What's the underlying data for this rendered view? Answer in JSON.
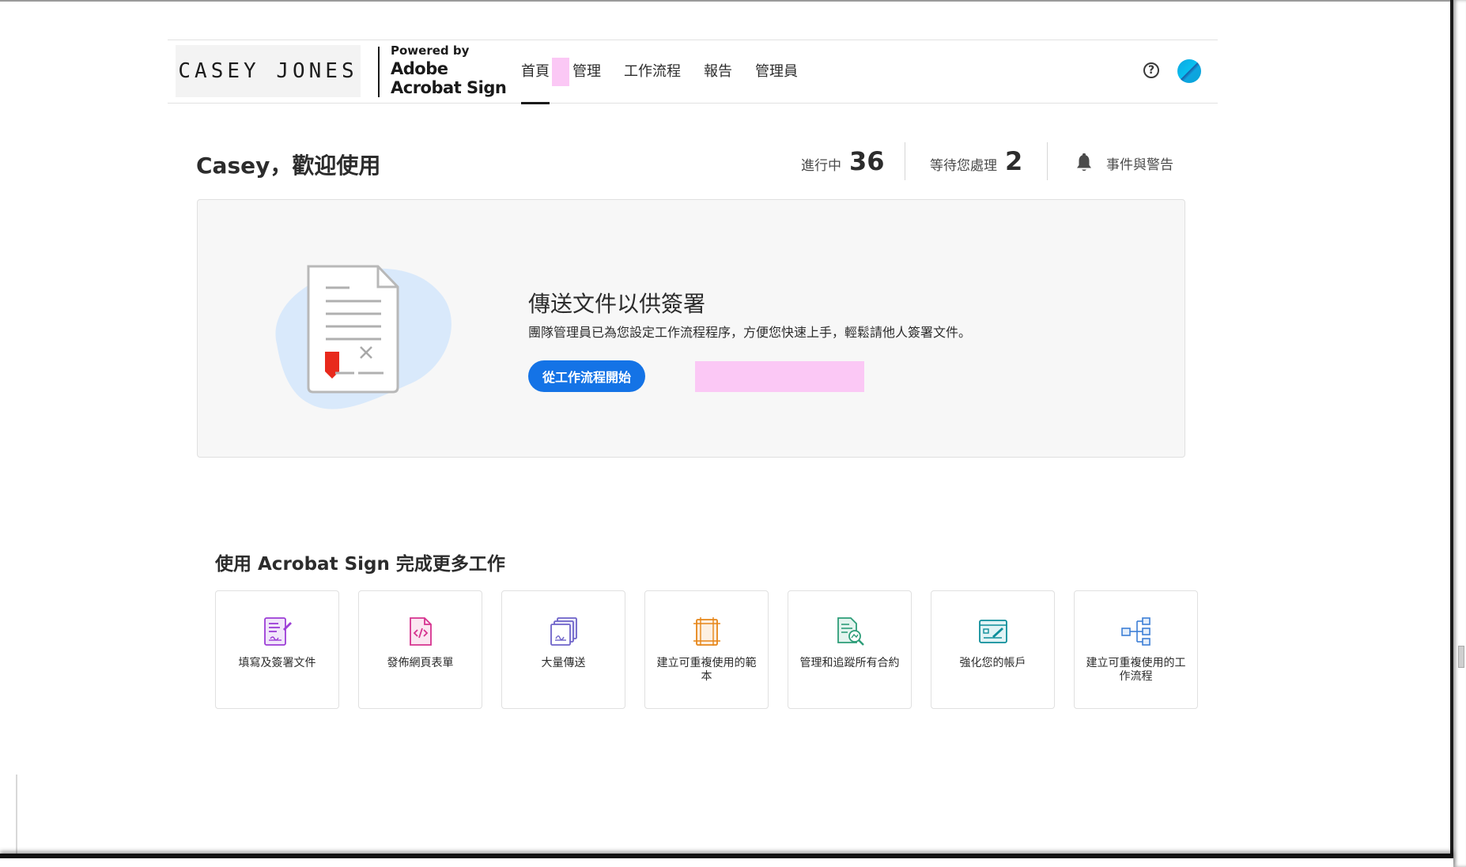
{
  "header": {
    "brand_name": "CASEY JONES",
    "powered_by": "Powered by",
    "product_line1": "Adobe",
    "product_line2": "Acrobat Sign",
    "nav": [
      {
        "label": "首頁",
        "active": true
      },
      {
        "label": "管理",
        "active": false
      },
      {
        "label": "工作流程",
        "active": false
      },
      {
        "label": "報告",
        "active": false
      },
      {
        "label": "管理員",
        "active": false
      }
    ],
    "help_icon": "question-circle-icon",
    "avatar_color": "#0ea5e0"
  },
  "welcome": {
    "greeting": "Casey，歡迎使用",
    "in_progress_label": "進行中",
    "in_progress_count": "36",
    "waiting_label": "等待您處理",
    "waiting_count": "2",
    "alerts_label": "事件與警告",
    "alerts_icon": "bell-icon"
  },
  "hero": {
    "title": "傳送文件以供簽署",
    "description": "團隊管理員已為您設定工作流程程序，方便您快速上手，輕鬆請他人簽署文件。",
    "button_label": "從工作流程開始",
    "button_color": "#1473e6",
    "illustration": "document-signature-icon"
  },
  "more": {
    "title": "使用 Acrobat Sign 完成更多工作",
    "tiles": [
      {
        "label": "填寫及簽署文件",
        "icon": "fill-sign-icon",
        "color": "#9c3dd6"
      },
      {
        "label": "發佈網頁表單",
        "icon": "web-form-icon",
        "color": "#d6338f"
      },
      {
        "label": "大量傳送",
        "icon": "bulk-send-icon",
        "color": "#6e63c9"
      },
      {
        "label": "建立可重複使用的範本",
        "icon": "template-icon",
        "color": "#e68619"
      },
      {
        "label": "管理和追蹤所有合約",
        "icon": "manage-track-icon",
        "color": "#2d9d78"
      },
      {
        "label": "強化您的帳戶",
        "icon": "account-branding-icon",
        "color": "#0d8e9a"
      },
      {
        "label": "建立可重複使用的工作流程",
        "icon": "workflow-icon",
        "color": "#3d7fd6"
      }
    ]
  }
}
